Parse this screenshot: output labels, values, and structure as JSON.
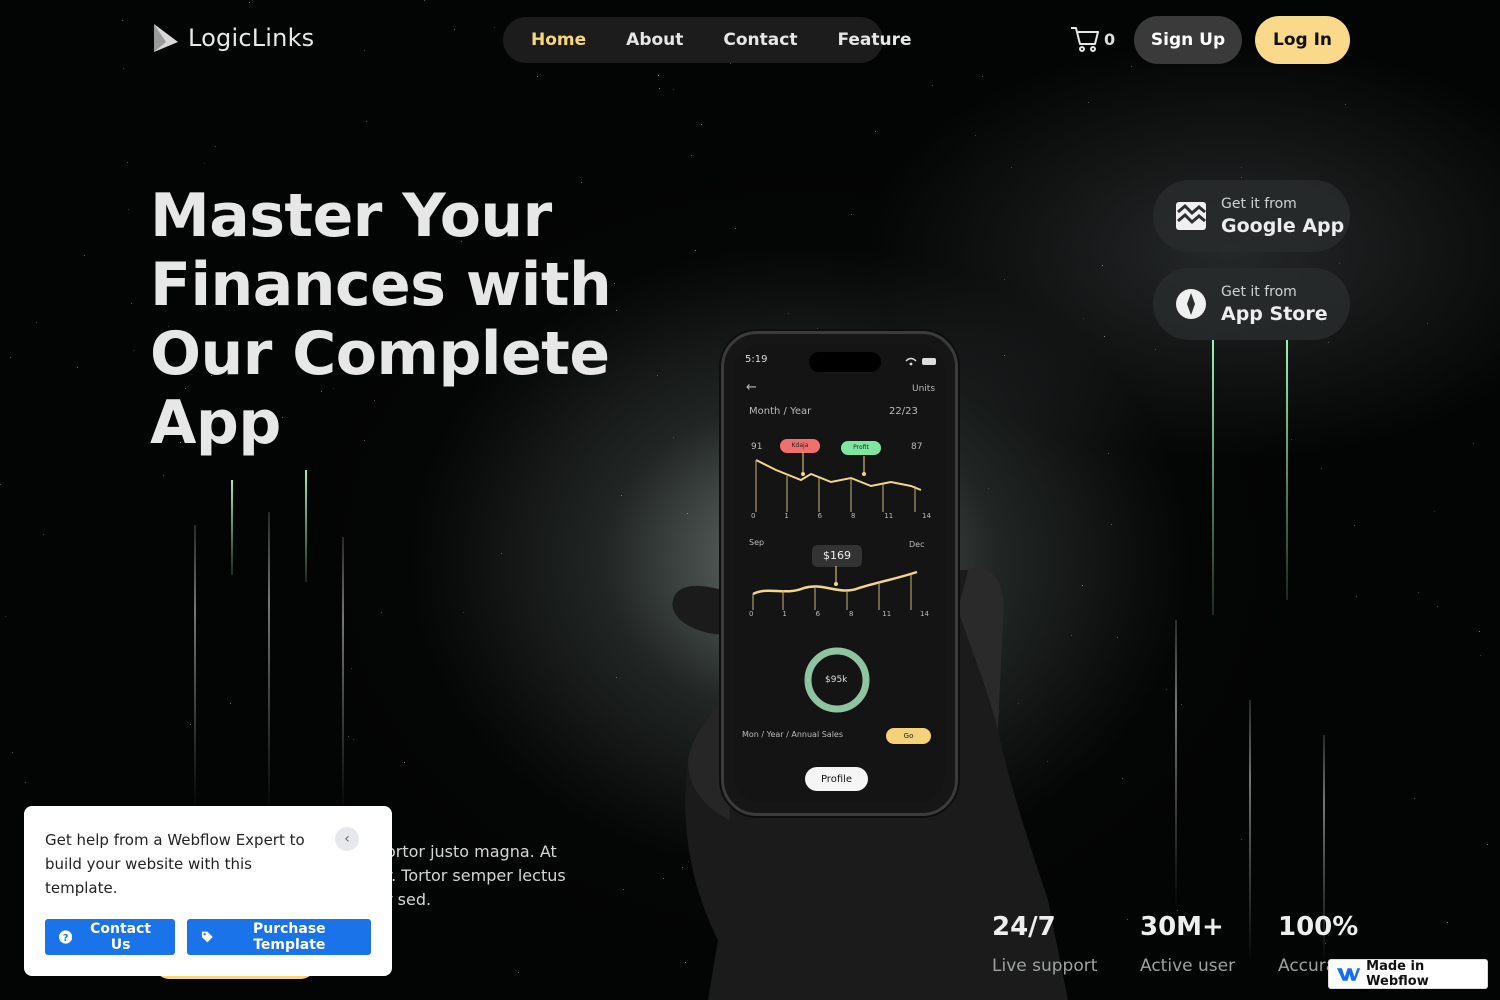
{
  "brand": {
    "name": "LogicLinks"
  },
  "nav": {
    "items": [
      "Home",
      "About",
      "Contact",
      "Feature"
    ],
    "active": "Home"
  },
  "header": {
    "cart_count": "0",
    "signup_label": "Sign Up",
    "login_label": "Log In"
  },
  "hero": {
    "title": "Master Your Finances with Our Complete App",
    "paragraph_visible_line1": "ortor justo magna. At",
    "paragraph_visible_line2": "r. Tortor semper lectus",
    "paragraph_visible_line3": "r sed."
  },
  "stores": [
    {
      "small": "Get it from",
      "big": "Google App",
      "icon": "google-play-icon"
    },
    {
      "small": "Get it from",
      "big": "App Store",
      "icon": "app-store-icon"
    }
  ],
  "stats": [
    {
      "value": "24/7",
      "label": "Live support"
    },
    {
      "value": "30M+",
      "label": "Active user"
    },
    {
      "value": "100%",
      "label": "Accura"
    }
  ],
  "phone": {
    "time": "5:19",
    "units": "Units",
    "month_year": "Month / Year",
    "period": "22/23",
    "chart1": {
      "left_val": "91",
      "right_val": "87",
      "tag_red": "Kdaja",
      "tag_green": "Profit",
      "ticks": [
        "0",
        "1",
        "6",
        "8",
        "11",
        "14"
      ]
    },
    "chart2": {
      "left_label": "Sep",
      "right_label": "Dec",
      "bubble": "$169",
      "ticks": [
        "0",
        "1",
        "6",
        "8",
        "11",
        "14"
      ]
    },
    "donut_label": "$95k",
    "sales_label": "Mon / Year / Annual Sales",
    "go_label": "Go",
    "profile_label": "Profile"
  },
  "help_popup": {
    "text": "Get help from a Webflow Expert to build your website with this template.",
    "contact_label": "Contact Us",
    "purchase_label": "Purchase Template"
  },
  "badge": {
    "label": "Made in Webflow"
  },
  "colors": {
    "accent": "#f8d77a",
    "button_blue": "#1a73e8",
    "green_line": "#a0ffbe"
  }
}
